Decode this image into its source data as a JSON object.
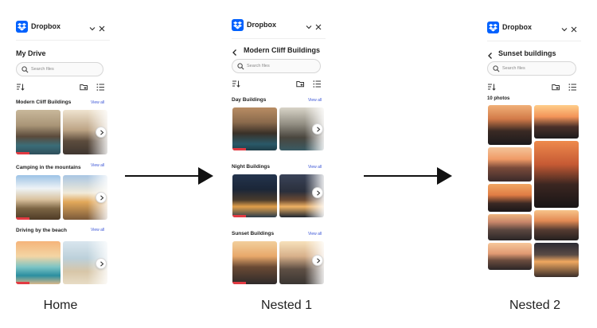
{
  "app": {
    "brand": "Dropbox"
  },
  "colors": {
    "accent": "#0061fe",
    "link": "#3b55d6",
    "progress": "#e23a42"
  },
  "search": {
    "placeholder": "Search files"
  },
  "home": {
    "title": "My Drive",
    "sections": [
      {
        "title": "Modern Cliff Buildings",
        "link": "View all"
      },
      {
        "title": "Camping in the mountains",
        "link": "View all"
      },
      {
        "title": "Driving by the beach",
        "link": "View all"
      }
    ]
  },
  "nested1": {
    "title": "Modern Cliff Buildings",
    "sections": [
      {
        "title": "Day Buildings",
        "link": "View all"
      },
      {
        "title": "Night Buildings",
        "link": "View all"
      },
      {
        "title": "Sunset Buildings",
        "link": "View all"
      }
    ]
  },
  "nested2": {
    "title": "Sunset buildings",
    "count": "10 photos"
  },
  "captions": {
    "home": "Home",
    "nested1": "Nested 1",
    "nested2": "Nested 2"
  },
  "icons": [
    "dropbox-logo-icon",
    "chevron-down-icon",
    "close-icon",
    "back-arrow-icon",
    "search-icon",
    "sort-icon",
    "new-folder-icon",
    "list-view-icon",
    "chevron-right-icon",
    "flow-arrow-icon"
  ]
}
